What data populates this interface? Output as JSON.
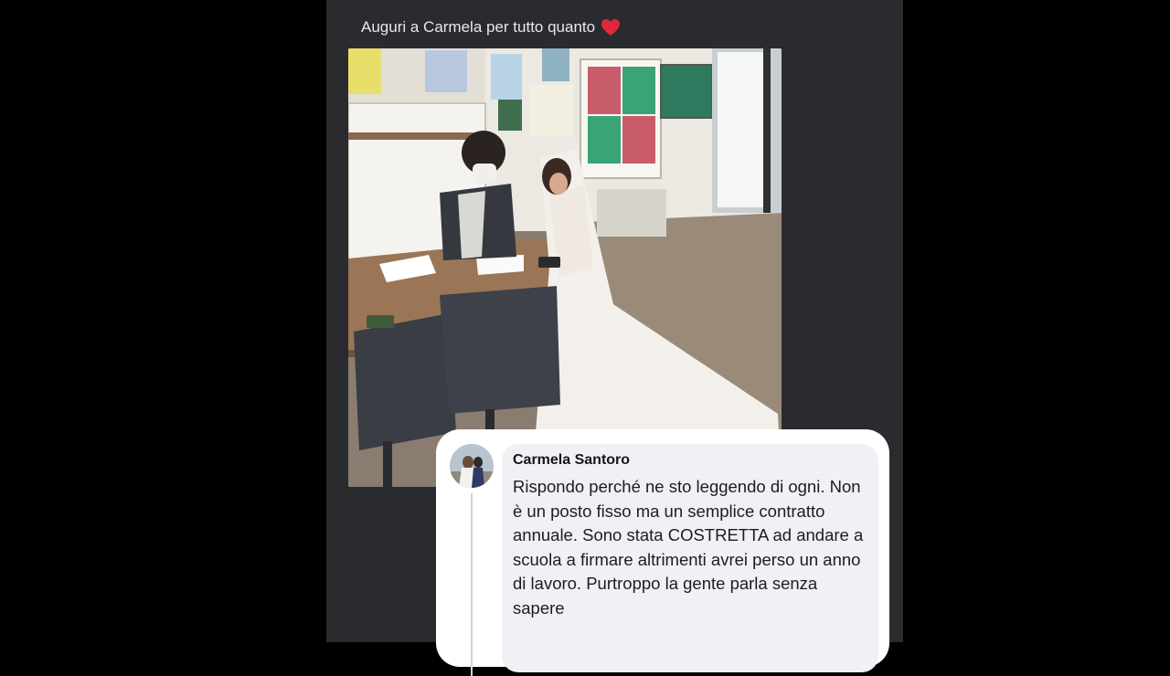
{
  "post": {
    "text": "Auguri a Carmela per tutto quanto",
    "emoji": "heart-emoji"
  },
  "photo": {
    "description_icon": "photo-wedding-classroom"
  },
  "comment": {
    "author": "Carmela Santoro",
    "text": "Rispondo perché ne sto leggendo di ogni. Non è un posto fisso ma un semplice contratto annuale. Sono stata COSTRETTA ad andare a scuola a firmare altrimenti avrei perso un anno di lavoro. Purtroppo la gente parla senza sapere",
    "avatar_icon": "avatar-photo"
  },
  "colors": {
    "page_background": "#000000",
    "panel": "#2a2b2e",
    "heart": "#e0283a",
    "bubble": "#eff1f4"
  }
}
